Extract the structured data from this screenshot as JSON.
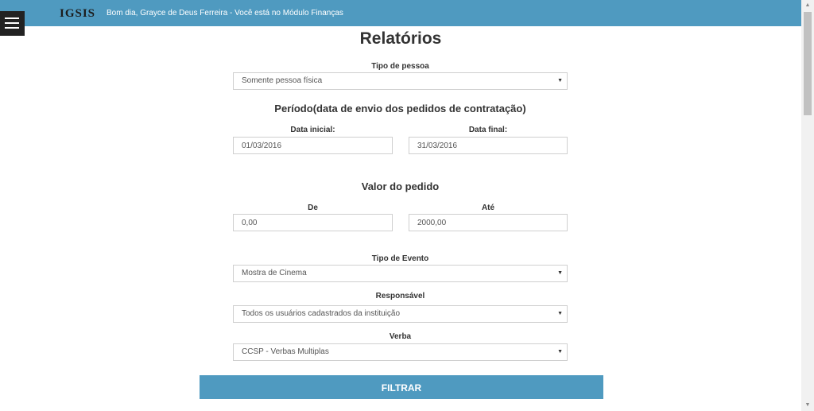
{
  "header": {
    "brand": "IGSIS",
    "greeting": "Bom dia, Grayce de Deus Ferreira - Você está no Módulo Finanças"
  },
  "page": {
    "title": "Relatórios"
  },
  "tipo_pessoa": {
    "label": "Tipo de pessoa",
    "value": "Somente pessoa física"
  },
  "periodo": {
    "heading": "Período(data de envio dos pedidos de contratação)",
    "inicial_label": "Data inicial:",
    "inicial_value": "01/03/2016",
    "final_label": "Data final:",
    "final_value": "31/03/2016"
  },
  "valor": {
    "heading": "Valor do pedido",
    "de_label": "De",
    "de_value": "0,00",
    "ate_label": "Até",
    "ate_value": "2000,00"
  },
  "tipo_evento": {
    "label": "Tipo de Evento",
    "value": "Mostra de Cinema"
  },
  "responsavel": {
    "label": "Responsável",
    "value": "Todos os usuários cadastrados da instituição"
  },
  "verba": {
    "label": "Verba",
    "value": "CCSP - Verbas Multiplas"
  },
  "actions": {
    "filter_label": "FILTRAR"
  },
  "icons": {
    "menu": "hamburger-menu-icon",
    "caret": "caret-down-icon"
  },
  "colors": {
    "accent": "#4f9ac0",
    "menu_bg": "#222222"
  }
}
